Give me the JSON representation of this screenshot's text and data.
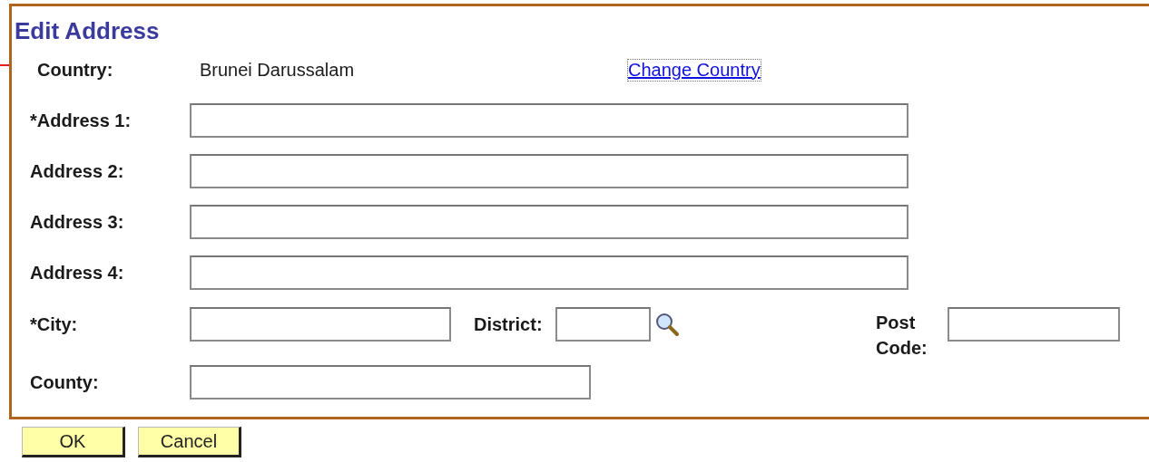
{
  "title": "Edit Address",
  "country": {
    "label": "Country:",
    "value": "Brunei Darussalam",
    "link": "Change Country"
  },
  "address_lines": [
    {
      "label": "*Address 1:"
    },
    {
      "label": "Address 2:"
    },
    {
      "label": "Address 3:"
    },
    {
      "label": "Address 4:"
    }
  ],
  "city": {
    "label": "*City:"
  },
  "district": {
    "label": "District:"
  },
  "post_code": {
    "label": "Post Code:"
  },
  "county": {
    "label": "County:"
  },
  "buttons": [
    "OK",
    "Cancel"
  ]
}
